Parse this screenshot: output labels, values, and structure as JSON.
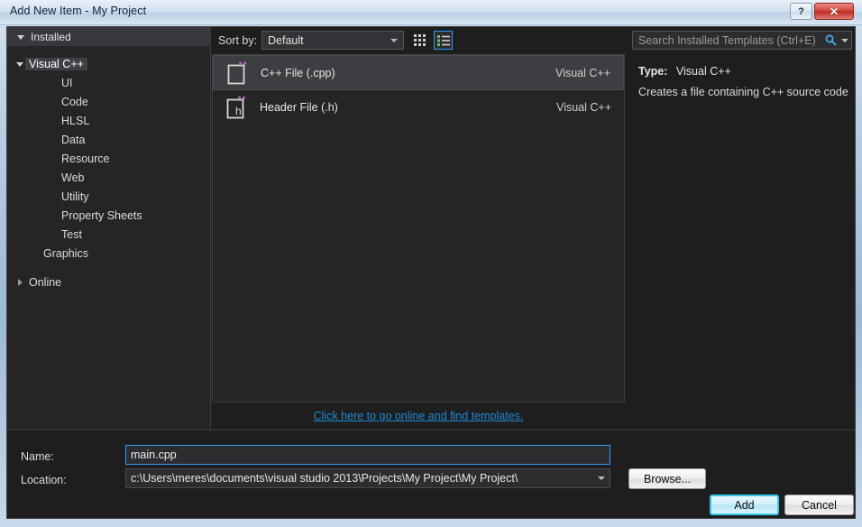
{
  "window": {
    "title": "Add New Item - My Project",
    "help_button": "?",
    "close_button": "✕"
  },
  "sidebar": {
    "header": "Installed",
    "items": [
      {
        "label": "Visual C++",
        "level": 0,
        "twisty": "down",
        "selected": true
      },
      {
        "label": "UI",
        "level": 2,
        "twisty": "none",
        "selected": false
      },
      {
        "label": "Code",
        "level": 2,
        "twisty": "none",
        "selected": false
      },
      {
        "label": "HLSL",
        "level": 2,
        "twisty": "none",
        "selected": false
      },
      {
        "label": "Data",
        "level": 2,
        "twisty": "none",
        "selected": false
      },
      {
        "label": "Resource",
        "level": 2,
        "twisty": "none",
        "selected": false
      },
      {
        "label": "Web",
        "level": 2,
        "twisty": "none",
        "selected": false
      },
      {
        "label": "Utility",
        "level": 2,
        "twisty": "none",
        "selected": false
      },
      {
        "label": "Property Sheets",
        "level": 2,
        "twisty": "none",
        "selected": false
      },
      {
        "label": "Test",
        "level": 2,
        "twisty": "none",
        "selected": false
      },
      {
        "label": "Graphics",
        "level": 1,
        "twisty": "none",
        "selected": false
      },
      {
        "label": "Online",
        "level": 0,
        "twisty": "right",
        "selected": false,
        "spacer_before": true
      }
    ]
  },
  "toolbar": {
    "sort_by_label": "Sort by:",
    "sort_by_value": "Default",
    "grid_view_icon": "grid-view-icon",
    "list_view_icon": "list-view-icon"
  },
  "search": {
    "placeholder": "Search Installed Templates (Ctrl+E)",
    "value": "",
    "icon": "search-icon",
    "dropdown_icon": "chevron-down-icon"
  },
  "templates": [
    {
      "name": "C++ File (.cpp)",
      "language": "Visual C++",
      "icon": "cpp-file-icon",
      "glyph": "",
      "selected": true
    },
    {
      "name": "Header File (.h)",
      "language": "Visual C++",
      "icon": "header-file-icon",
      "glyph": "h",
      "selected": false
    }
  ],
  "online_link": "Click here to go online and find templates.",
  "info": {
    "type_label": "Type:",
    "type_value": "Visual C++",
    "description": "Creates a file containing C++ source code"
  },
  "fields": {
    "name_label": "Name:",
    "name_value": "main.cpp",
    "location_label": "Location:",
    "location_value": "c:\\Users\\meres\\documents\\visual studio 2013\\Projects\\My Project\\My Project\\"
  },
  "buttons": {
    "browse": "Browse...",
    "add": "Add",
    "cancel": "Cancel"
  },
  "colors": {
    "dialog_background": "#1e1e1e",
    "panel_background": "#252526",
    "selection": "#3e3e42",
    "accent_blue": "#3399ff",
    "link_blue": "#1d8ad6",
    "icon_purple": "#b06cc0"
  }
}
